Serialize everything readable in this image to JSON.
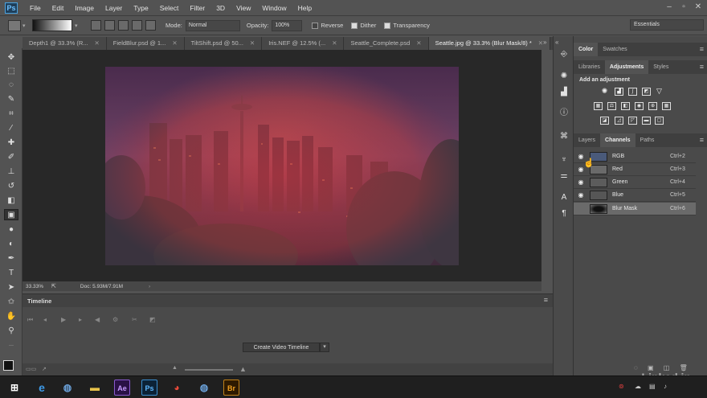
{
  "app": {
    "logo": "Ps"
  },
  "menu": [
    "File",
    "Edit",
    "Image",
    "Layer",
    "Type",
    "Select",
    "Filter",
    "3D",
    "View",
    "Window",
    "Help"
  ],
  "options": {
    "mode_label": "Mode:",
    "mode_value": "Normal",
    "opacity_label": "Opacity:",
    "opacity_value": "100%",
    "reverse": "Reverse",
    "dither": "Dither",
    "transparency": "Transparency",
    "workspace": "Essentials"
  },
  "tabs": [
    {
      "label": "Depth1 @ 33.3% (R..."
    },
    {
      "label": "FieldBlur.psd @ 1..."
    },
    {
      "label": "TiltShift.psd @ 50..."
    },
    {
      "label": "Iris.NEF @ 12.5% (..."
    },
    {
      "label": "Seattle_Complete.psd"
    },
    {
      "label": "Seattle.jpg @ 33.3% (Blur Mask/8) *"
    }
  ],
  "status": {
    "zoom": "33.33%",
    "doc": "Doc: 5.93M/7.91M"
  },
  "timeline": {
    "title": "Timeline",
    "create_button": "Create Video Timeline"
  },
  "right_panel": {
    "top_tabs": [
      "Color",
      "Swatches"
    ],
    "mid_tabs": [
      "Libraries",
      "Adjustments",
      "Styles"
    ],
    "adjust_title": "Add an adjustment",
    "layer_tabs": [
      "Layers",
      "Channels",
      "Paths"
    ],
    "channels": [
      {
        "name": "RGB",
        "key": "Ctrl+2"
      },
      {
        "name": "Red",
        "key": "Ctrl+3"
      },
      {
        "name": "Green",
        "key": "Ctrl+4"
      },
      {
        "name": "Blue",
        "key": "Ctrl+5"
      },
      {
        "name": "Blur Mask",
        "key": "Ctrl+6"
      }
    ]
  },
  "watermark": "Linked in",
  "colors": {
    "accent": "#6fc2ff",
    "mask_red": "#b8323c",
    "panel": "#4a4a4a"
  }
}
